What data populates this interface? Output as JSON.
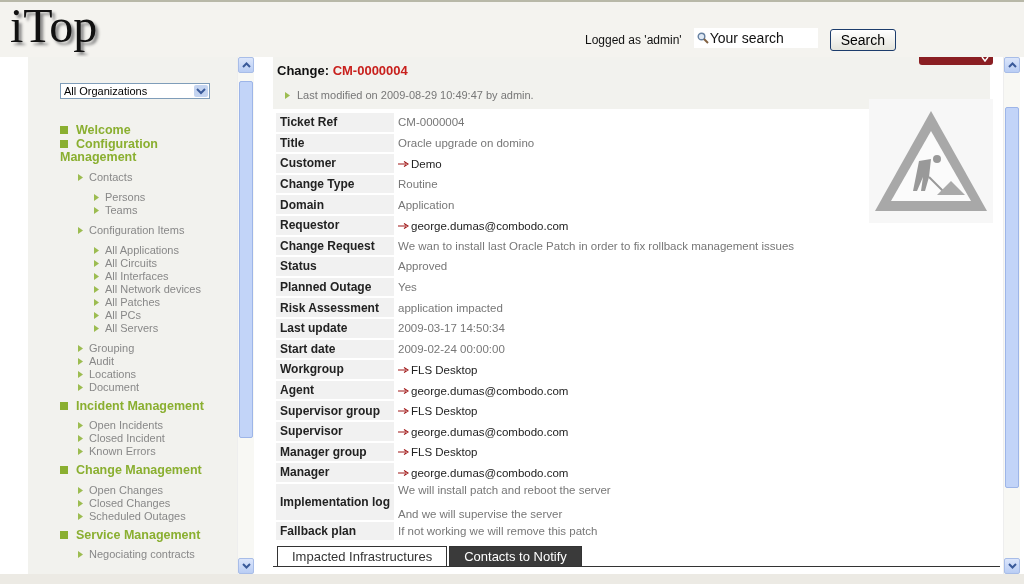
{
  "header": {
    "logo": "iTop",
    "user_label": "Logged as 'admin'",
    "search": {
      "placeholder": "Your search"
    },
    "search_button": "Search"
  },
  "sidebar": {
    "organization": "All Organizations",
    "menu": [
      {
        "label": "Welcome"
      },
      {
        "label": "Configuration Management",
        "children": [
          {
            "label": "Contacts",
            "children": [
              {
                "label": "Persons"
              },
              {
                "label": "Teams"
              }
            ]
          },
          {
            "label": "Configuration Items",
            "children": [
              {
                "label": "All Applications"
              },
              {
                "label": "All Circuits"
              },
              {
                "label": "All Interfaces"
              },
              {
                "label": "All Network devices"
              },
              {
                "label": "All Patches"
              },
              {
                "label": "All PCs"
              },
              {
                "label": "All Servers"
              }
            ]
          },
          {
            "label": "Grouping"
          },
          {
            "label": "Audit"
          },
          {
            "label": "Locations"
          },
          {
            "label": "Document"
          }
        ]
      },
      {
        "label": "Incident Management",
        "children": [
          {
            "label": "Open Incidents"
          },
          {
            "label": "Closed Incident"
          },
          {
            "label": "Known Errors"
          }
        ]
      },
      {
        "label": "Change Management",
        "children": [
          {
            "label": "Open Changes"
          },
          {
            "label": "Closed Changes"
          },
          {
            "label": "Scheduled Outages"
          }
        ]
      },
      {
        "label": "Service Management",
        "children": [
          {
            "label": "Negociating contracts"
          }
        ]
      }
    ]
  },
  "details": {
    "title_prefix": "Change:",
    "ref": "CM-0000004",
    "last_modified": "Last modified on 2009-08-29 10:49:47 by admin.",
    "fields": [
      {
        "label": "Ticket Ref",
        "kind": "text",
        "lines": [
          "CM-0000004"
        ]
      },
      {
        "label": "Title",
        "kind": "text",
        "lines": [
          "Oracle upgrade on domino"
        ]
      },
      {
        "label": "Customer",
        "kind": "link",
        "lines": [
          "Demo"
        ]
      },
      {
        "label": "Change Type",
        "kind": "text",
        "lines": [
          "Routine"
        ]
      },
      {
        "label": "Domain",
        "kind": "text",
        "lines": [
          "Application"
        ]
      },
      {
        "label": "Requestor",
        "kind": "link",
        "lines": [
          "george.dumas@combodo.com"
        ]
      },
      {
        "label": "Change Request",
        "kind": "text",
        "lines": [
          "We wan to install last Oracle Patch in order to fix rollback management issues"
        ]
      },
      {
        "label": "Status",
        "kind": "text",
        "lines": [
          "Approved"
        ]
      },
      {
        "label": "Planned Outage",
        "kind": "text",
        "lines": [
          "Yes"
        ]
      },
      {
        "label": "Risk Assessment",
        "kind": "text",
        "lines": [
          "application impacted"
        ]
      },
      {
        "label": "Last update",
        "kind": "text",
        "lines": [
          "2009-03-17 14:50:34"
        ]
      },
      {
        "label": "Start date",
        "kind": "text",
        "lines": [
          "2009-02-24 00:00:00"
        ]
      },
      {
        "label": "Workgroup",
        "kind": "link",
        "lines": [
          "FLS Desktop"
        ]
      },
      {
        "label": "Agent",
        "kind": "link",
        "lines": [
          "george.dumas@combodo.com"
        ]
      },
      {
        "label": "Supervisor group",
        "kind": "link",
        "lines": [
          "FLS Desktop"
        ]
      },
      {
        "label": "Supervisor",
        "kind": "link",
        "lines": [
          "george.dumas@combodo.com"
        ]
      },
      {
        "label": "Manager group",
        "kind": "link",
        "lines": [
          "FLS Desktop"
        ]
      },
      {
        "label": "Manager",
        "kind": "link",
        "lines": [
          "george.dumas@combodo.com"
        ]
      },
      {
        "label": "Implementation log",
        "kind": "text",
        "lines": [
          "We will install patch and reboot the server",
          "And we will supervise the server"
        ]
      },
      {
        "label": "Fallback plan",
        "kind": "text",
        "lines": [
          "If not working we will remove this patch"
        ]
      }
    ],
    "tabs": [
      {
        "label": "Impacted Infrastructures",
        "selected": true
      },
      {
        "label": "Contacts to Notify",
        "selected": false
      }
    ]
  }
}
